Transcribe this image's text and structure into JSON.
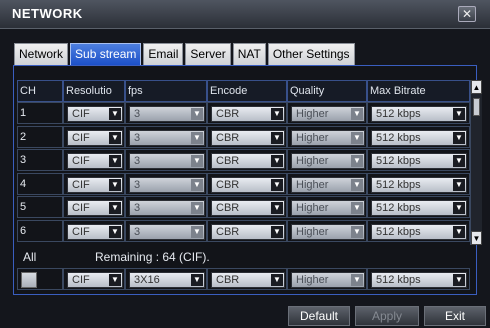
{
  "window": {
    "title": "NETWORK",
    "close_glyph": "✕"
  },
  "tabs": [
    {
      "label": "Network"
    },
    {
      "label": "Sub stream",
      "active": true
    },
    {
      "label": "Email"
    },
    {
      "label": "Server"
    },
    {
      "label": "NAT"
    },
    {
      "label": "Other Settings"
    }
  ],
  "table": {
    "columns": [
      "CH",
      "Resolutio",
      "fps",
      "Encode",
      "Quality",
      "Max Bitrate"
    ],
    "rows": [
      {
        "ch": "1",
        "resolution": "CIF",
        "fps": "3",
        "encode": "CBR",
        "quality": "Higher",
        "bitrate": "512 kbps"
      },
      {
        "ch": "2",
        "resolution": "CIF",
        "fps": "3",
        "encode": "CBR",
        "quality": "Higher",
        "bitrate": "512 kbps"
      },
      {
        "ch": "3",
        "resolution": "CIF",
        "fps": "3",
        "encode": "CBR",
        "quality": "Higher",
        "bitrate": "512 kbps"
      },
      {
        "ch": "4",
        "resolution": "CIF",
        "fps": "3",
        "encode": "CBR",
        "quality": "Higher",
        "bitrate": "512 kbps"
      },
      {
        "ch": "5",
        "resolution": "CIF",
        "fps": "3",
        "encode": "CBR",
        "quality": "Higher",
        "bitrate": "512 kbps"
      },
      {
        "ch": "6",
        "resolution": "CIF",
        "fps": "3",
        "encode": "CBR",
        "quality": "Higher",
        "bitrate": "512 kbps"
      }
    ],
    "arrow_glyph": "▼"
  },
  "all": {
    "label": "All",
    "remaining": "Remaining : 64 (CIF).",
    "resolution": "CIF",
    "fps": "3X16",
    "encode": "CBR",
    "quality": "Higher",
    "bitrate": "512 kbps"
  },
  "scroll": {
    "up_glyph": "▲",
    "down_glyph": "▼"
  },
  "buttons": {
    "default": "Default",
    "apply": "Apply",
    "exit": "Exit"
  },
  "colors": {
    "active_tab": "#2f63d8",
    "grid_border": "#3a5ec0",
    "background": "#14161c"
  }
}
